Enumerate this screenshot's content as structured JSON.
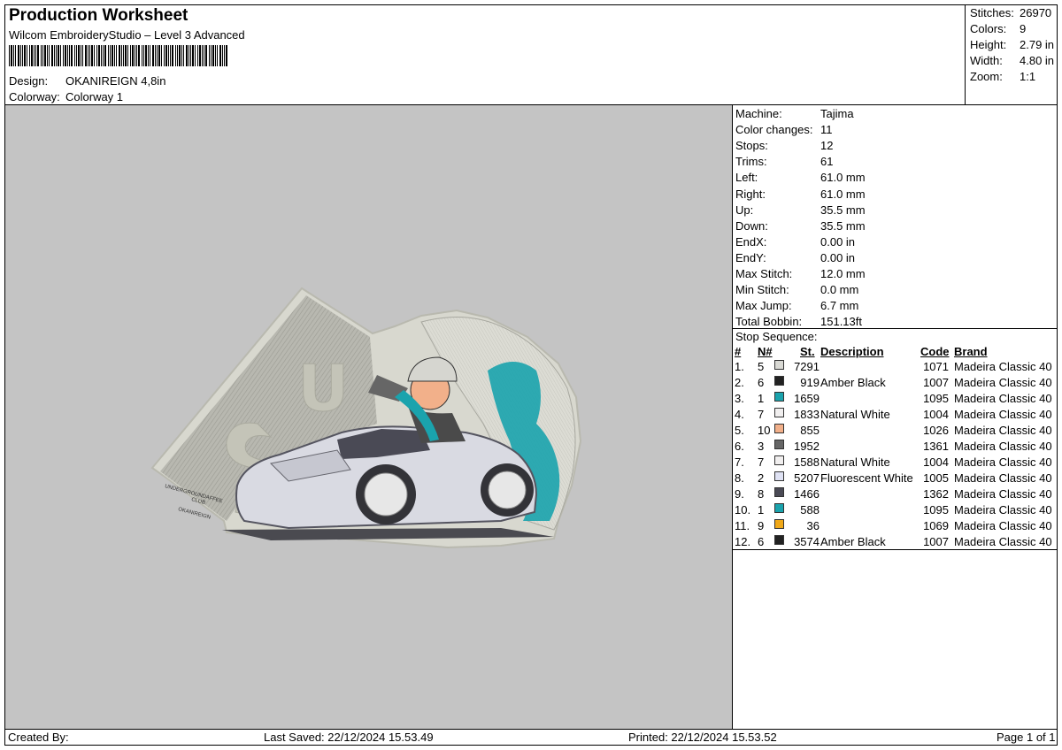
{
  "header": {
    "title": "Production Worksheet",
    "subtitle": "Wilcom EmbroideryStudio – Level 3 Advanced",
    "design_label": "Design:",
    "design_value": "OKANIREIGN 4,8in",
    "colorway_label": "Colorway:",
    "colorway_value": "Colorway 1"
  },
  "stats": [
    {
      "label": "Stitches:",
      "value": "26970"
    },
    {
      "label": "Colors:",
      "value": "9"
    },
    {
      "label": "Height:",
      "value": "2.79 in"
    },
    {
      "label": "Width:",
      "value": "4.80 in"
    },
    {
      "label": "Zoom:",
      "value": "1:1"
    }
  ],
  "machine_info": [
    {
      "label": "Machine:",
      "value": "Tajima"
    },
    {
      "label": "Color changes:",
      "value": "11"
    },
    {
      "label": "Stops:",
      "value": "12"
    },
    {
      "label": "Trims:",
      "value": "61"
    },
    {
      "label": "Left:",
      "value": "61.0 mm"
    },
    {
      "label": "Right:",
      "value": "61.0 mm"
    },
    {
      "label": "Up:",
      "value": "35.5 mm"
    },
    {
      "label": "Down:",
      "value": "35.5 mm"
    },
    {
      "label": "EndX:",
      "value": "0.00 in"
    },
    {
      "label": "EndY:",
      "value": "0.00 in"
    },
    {
      "label": "Max Stitch:",
      "value": "12.0 mm"
    },
    {
      "label": "Min Stitch:",
      "value": "0.0 mm"
    },
    {
      "label": "Max Jump:",
      "value": "6.7 mm"
    },
    {
      "label": "Total Bobbin:",
      "value": "151.13ft"
    }
  ],
  "stop_sequence": {
    "title": "Stop Sequence:",
    "headers": {
      "num": "#",
      "n": "N#",
      "st": "St.",
      "description": "Description",
      "code": "Code",
      "brand": "Brand"
    },
    "rows": [
      {
        "num": "1.",
        "n": "5",
        "color": "#d9d9d4",
        "st": "7291",
        "description": "",
        "code": "1071",
        "brand": "Madeira Classic 40"
      },
      {
        "num": "2.",
        "n": "6",
        "color": "#222222",
        "st": "919",
        "description": "Amber Black",
        "code": "1007",
        "brand": "Madeira Classic 40"
      },
      {
        "num": "3.",
        "n": "1",
        "color": "#1aa3ad",
        "st": "1659",
        "description": "",
        "code": "1095",
        "brand": "Madeira Classic 40"
      },
      {
        "num": "4.",
        "n": "7",
        "color": "#f1efef",
        "st": "1833",
        "description": "Natural White",
        "code": "1004",
        "brand": "Madeira Classic 40"
      },
      {
        "num": "5.",
        "n": "10",
        "color": "#f2b08a",
        "st": "855",
        "description": "",
        "code": "1026",
        "brand": "Madeira Classic 40"
      },
      {
        "num": "6.",
        "n": "3",
        "color": "#666666",
        "st": "1952",
        "description": "",
        "code": "1361",
        "brand": "Madeira Classic 40"
      },
      {
        "num": "7.",
        "n": "7",
        "color": "#f1efef",
        "st": "1588",
        "description": "Natural White",
        "code": "1004",
        "brand": "Madeira Classic 40"
      },
      {
        "num": "8.",
        "n": "2",
        "color": "#dfe2f4",
        "st": "5207",
        "description": "Fluorescent White",
        "code": "1005",
        "brand": "Madeira Classic 40"
      },
      {
        "num": "9.",
        "n": "8",
        "color": "#4a4a55",
        "st": "1466",
        "description": "",
        "code": "1362",
        "brand": "Madeira Classic 40"
      },
      {
        "num": "10.",
        "n": "1",
        "color": "#1aa3ad",
        "st": "588",
        "description": "",
        "code": "1095",
        "brand": "Madeira Classic 40"
      },
      {
        "num": "11.",
        "n": "9",
        "color": "#f0a818",
        "st": "36",
        "description": "",
        "code": "1069",
        "brand": "Madeira Classic 40"
      },
      {
        "num": "12.",
        "n": "6",
        "color": "#222222",
        "st": "3574",
        "description": "Amber Black",
        "code": "1007",
        "brand": "Madeira Classic 40"
      }
    ]
  },
  "design_art": {
    "letters": "U",
    "small_text": [
      "UNDERGROUNDAFFEE",
      "CLUB",
      "OKANIREIGN"
    ]
  },
  "footer": {
    "created_by": "Created By:",
    "last_saved": "Last Saved: 22/12/2024 15.53.49",
    "printed": "Printed: 22/12/2024 15.53.52",
    "page": "Page 1 of 1"
  },
  "colors": {
    "preview_bg": "#c4c4c4",
    "teal": "#1aa3ad"
  }
}
